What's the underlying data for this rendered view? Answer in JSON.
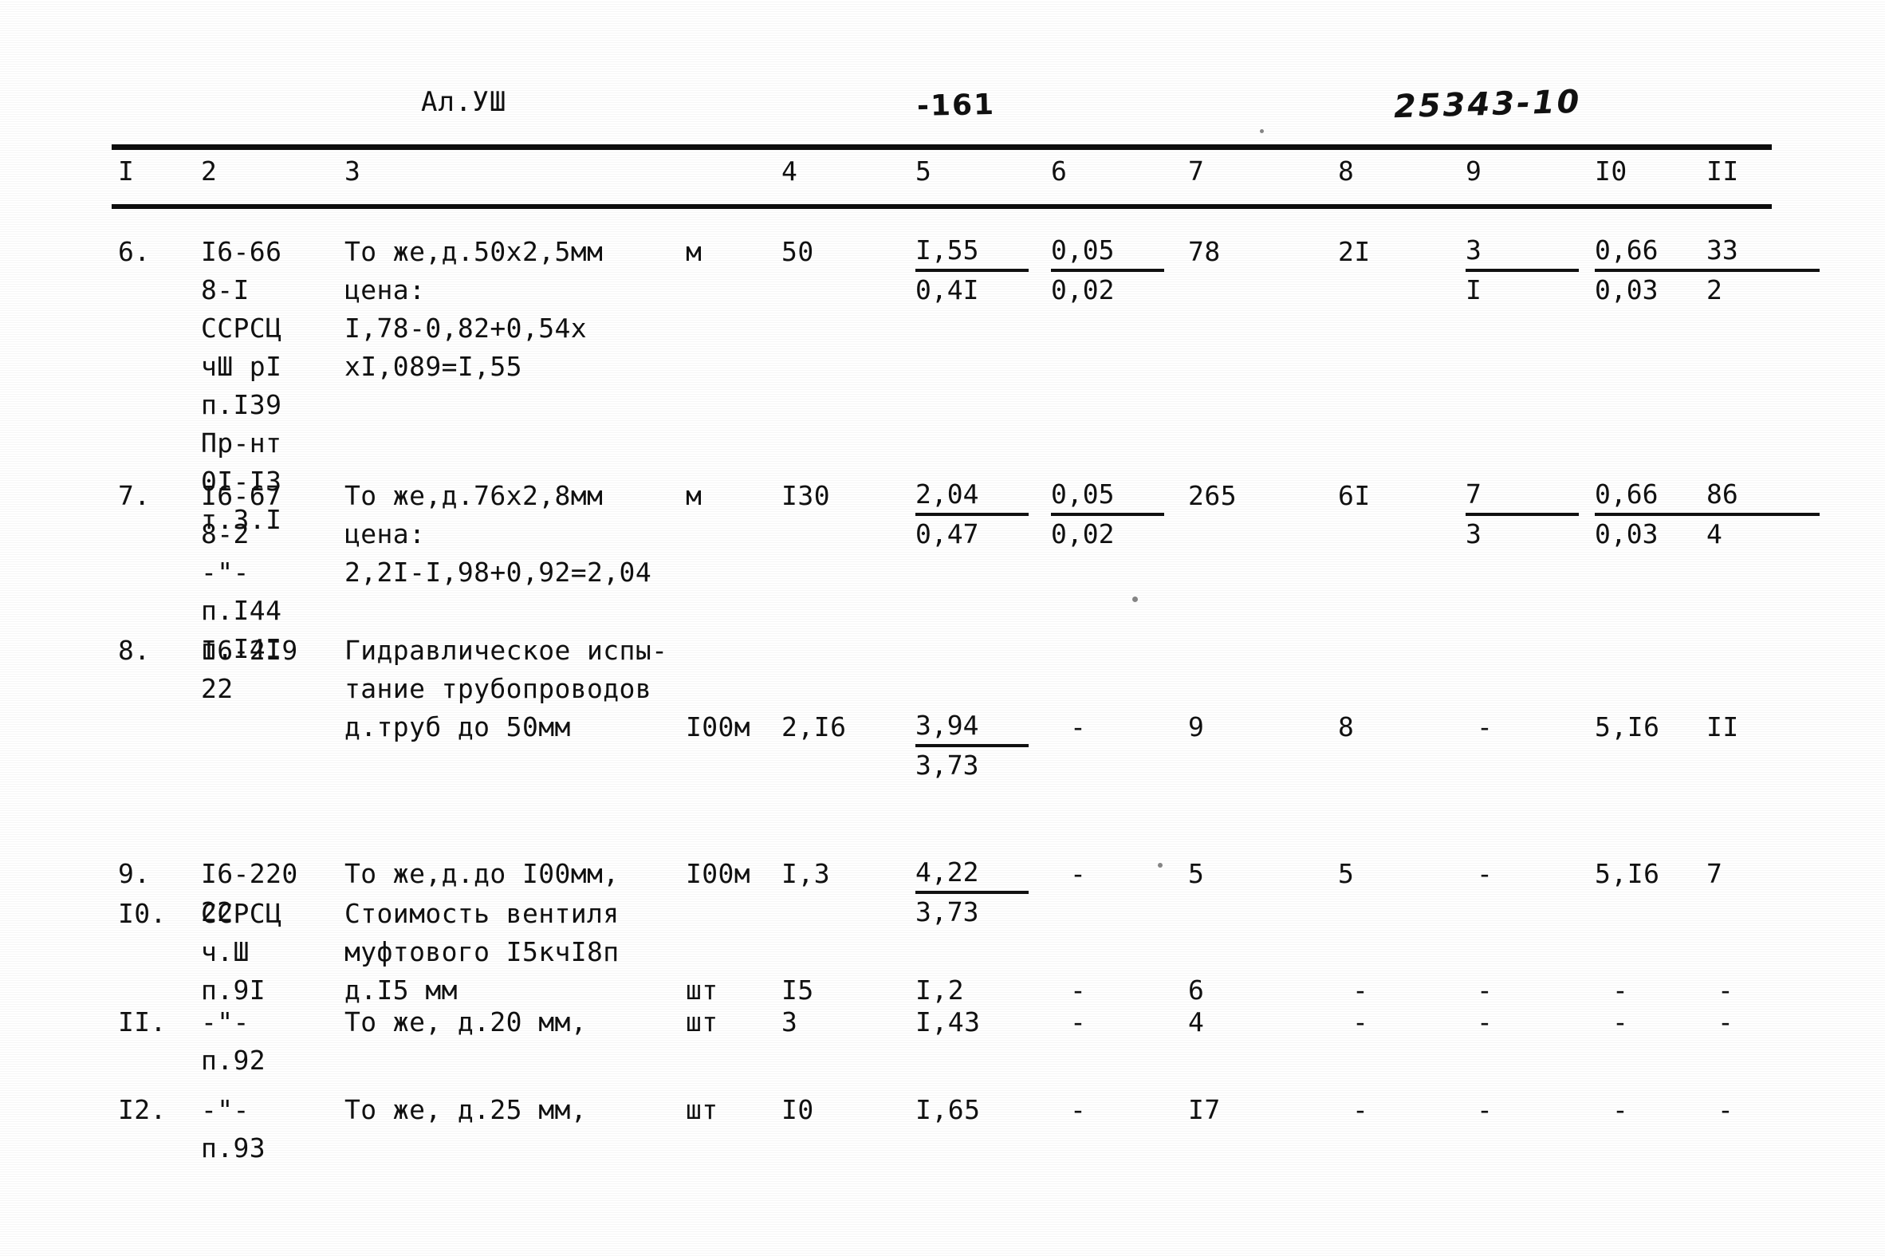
{
  "header": {
    "album_label": "Ал.УШ",
    "page_number": "-161",
    "doc_code": "25343-10"
  },
  "table": {
    "column_headers": [
      "I",
      "2",
      "3",
      "4",
      "5",
      "6",
      "7",
      "8",
      "9",
      "I0",
      "II"
    ],
    "rows": [
      {
        "num": "6.",
        "code_lines": "I6-66\n8-I\nССРСЦ\nчШ pI\nп.I39\nПр-нт\n0I-I3\nт.3.I",
        "description": "То же,д.50х2,5мм\nцена:\nI,78-0,82+0,54х\nхI,089=I,55",
        "unit": "м",
        "qty": "50",
        "c5_top": "I,55",
        "c5_bot": "0,4I",
        "c6_top": "0,05",
        "c6_bot": "0,02",
        "c7": "78",
        "c8": "2I",
        "c9_top": "3",
        "c9_bot": "I",
        "c10_top": "0,66",
        "c10_bot": "0,03",
        "c11_top": "33",
        "c11_bot": "2"
      },
      {
        "num": "7.",
        "code_lines": "I6-67\n8-2\n-\"-\nп.I44\nп.I4I",
        "description": "То же,д.76х2,8мм\nцена:\n2,2I-I,98+0,92=2,04",
        "unit": "м",
        "qty": "I30",
        "c5_top": "2,04",
        "c5_bot": "0,47",
        "c6_top": "0,05",
        "c6_bot": "0,02",
        "c7": "265",
        "c8": "6I",
        "c9_top": "7",
        "c9_bot": "3",
        "c10_top": "0,66",
        "c10_bot": "0,03",
        "c11_top": "86",
        "c11_bot": "4"
      },
      {
        "num": "8.",
        "code_lines": "I6-2I9\n22",
        "description": "Гидравлическое испы-\nтание трубопроводов\nд.труб до 50мм",
        "unit": "I00м",
        "qty": "2,I6",
        "c5_top": "3,94",
        "c5_bot": "3,73",
        "c6": "-",
        "c7": "9",
        "c8": "8",
        "c9": "-",
        "c10": "5,I6",
        "c11": "II"
      },
      {
        "num": "9.",
        "code_lines": "I6-220\n22",
        "description": "То же,д.до I00мм,",
        "unit": "I00м",
        "qty": "I,3",
        "c5_top": "4,22",
        "c5_bot": "3,73",
        "c6": "-",
        "c7": "5",
        "c8": "5",
        "c9": "-",
        "c10": "5,I6",
        "c11": "7"
      },
      {
        "num": "I0.",
        "code_lines": "ССРСЦ\nч.Ш\nп.9I",
        "description": "Стоимость вентиля\nмуфтового I5кчI8п\nд.I5 мм",
        "unit": "шт",
        "qty": "I5",
        "c5": "I,2",
        "c6": "-",
        "c7": "6",
        "c8": "-",
        "c9": "-",
        "c10": "-",
        "c11": "-"
      },
      {
        "num": "II.",
        "code_lines": "-\"-\nп.92",
        "description": "То же, д.20 мм,",
        "unit": "шт",
        "qty": "3",
        "c5": "I,43",
        "c6": "-",
        "c7": "4",
        "c8": "-",
        "c9": "-",
        "c10": "-",
        "c11": "-"
      },
      {
        "num": "I2.",
        "code_lines": "-\"-\nп.93",
        "description": "То же, д.25 мм,",
        "unit": "шт",
        "qty": "I0",
        "c5": "I,65",
        "c6": "-",
        "c7": "I7",
        "c8": "-",
        "c9": "-",
        "c10": "-",
        "c11": "-"
      }
    ]
  }
}
